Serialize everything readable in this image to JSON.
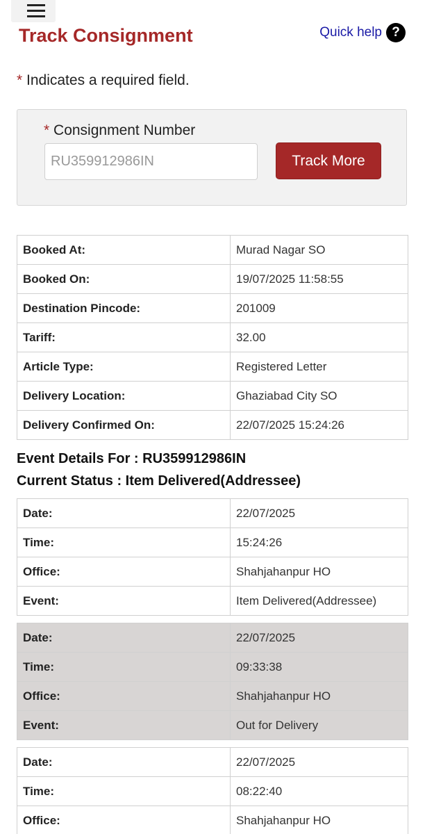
{
  "header": {
    "title": "Track Consignment",
    "quick_help_label": "Quick help",
    "help_icon_glyph": "?"
  },
  "form": {
    "required_star": "*",
    "required_note": " Indicates a required field.",
    "field_star": "*",
    "field_label": " Consignment Number",
    "consignment_value": "RU359912986IN",
    "track_button_label": "Track More"
  },
  "summary": {
    "rows": [
      {
        "label": "Booked At:",
        "value": "Murad Nagar SO"
      },
      {
        "label": "Booked On:",
        "value": "19/07/2025 11:58:55"
      },
      {
        "label": "Destination Pincode:",
        "value": "201009"
      },
      {
        "label": "Tariff:",
        "value": "32.00"
      },
      {
        "label": "Article Type:",
        "value": "Registered Letter"
      },
      {
        "label": "Delivery Location:",
        "value": "Ghaziabad City SO"
      },
      {
        "label": "Delivery Confirmed On:",
        "value": "22/07/2025 15:24:26"
      }
    ]
  },
  "events": {
    "details_heading": "Event Details For : RU359912986IN",
    "status_heading": "Current Status : Item Delivered(Addressee)",
    "labels": {
      "date": "Date:",
      "time": "Time:",
      "office": "Office:",
      "event": "Event:"
    },
    "list": [
      {
        "date": "22/07/2025",
        "time": "15:24:26",
        "office": "Shahjahanpur HO",
        "event": "Item Delivered(Addressee)"
      },
      {
        "date": "22/07/2025",
        "time": "09:33:38",
        "office": "Shahjahanpur HO",
        "event": "Out for Delivery"
      },
      {
        "date": "22/07/2025",
        "time": "08:22:40",
        "office": "Shahjahanpur HO",
        "event": ""
      }
    ]
  }
}
